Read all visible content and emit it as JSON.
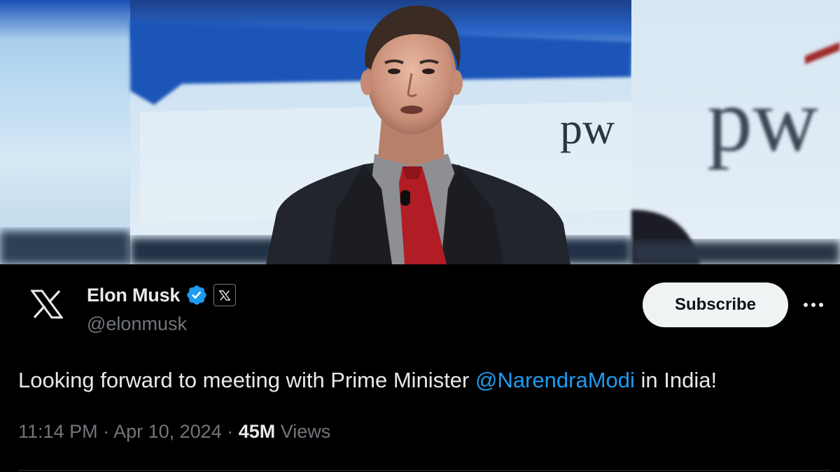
{
  "photo": {
    "icon": "speaker-photo",
    "sign_text": "pw"
  },
  "author": {
    "display_name": "Elon Musk",
    "handle": "@elonmusk",
    "avatar_icon": "x-logo-icon",
    "verified_icon": "verified-badge-icon",
    "affiliation_icon": "x-affiliation-icon"
  },
  "actions": {
    "subscribe_label": "Subscribe",
    "more_icon": "more-options-icon"
  },
  "tweet": {
    "text_before": "Looking forward to meeting with Prime Minister ",
    "mention": "@NarendraModi",
    "text_after": " in India!"
  },
  "meta": {
    "time": "11:14 PM",
    "separator": " · ",
    "date": "Apr 10, 2024",
    "views_count": "45M",
    "views_label": "Views"
  },
  "colors": {
    "background": "#000000",
    "text": "#e7e9ea",
    "muted": "#71767b",
    "link": "#1d9bf0",
    "verified": "#1d9bf0"
  }
}
